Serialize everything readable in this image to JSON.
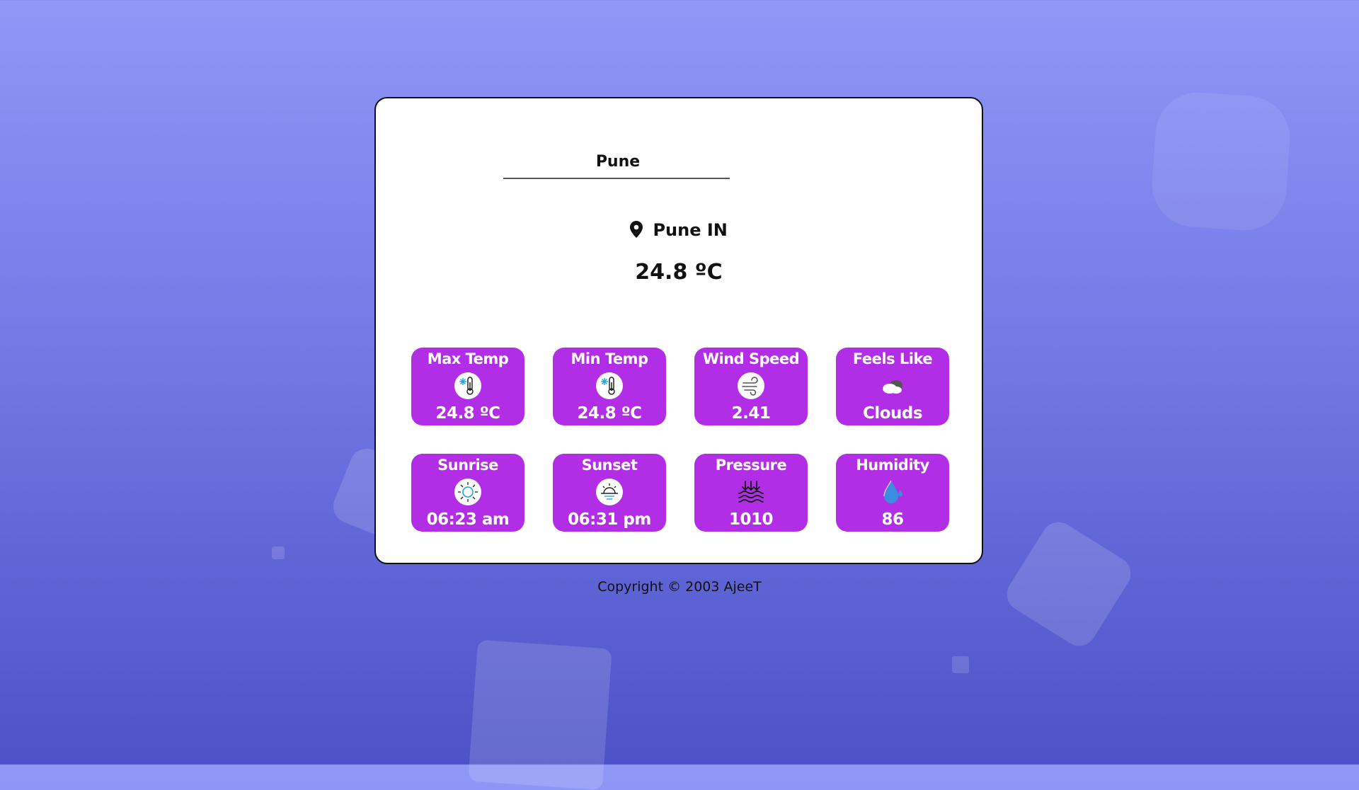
{
  "search": {
    "value": "Pune"
  },
  "location": {
    "text": "Pune IN",
    "icon": "map-pin-icon"
  },
  "current_temp": "24.8 ºC",
  "tiles": [
    {
      "label": "Max Temp",
      "value": "24.8 ºC",
      "icon": "thermometer-snow-icon"
    },
    {
      "label": "Min Temp",
      "value": "24.8 ºC",
      "icon": "thermometer-snow-icon"
    },
    {
      "label": "Wind Speed",
      "value": "2.41",
      "icon": "wind-icon"
    },
    {
      "label": "Feels Like",
      "value": "Clouds",
      "icon": "clouds-icon"
    },
    {
      "label": "Sunrise",
      "value": "06:23 am",
      "icon": "sun-icon"
    },
    {
      "label": "Sunset",
      "value": "06:31 pm",
      "icon": "sunset-icon"
    },
    {
      "label": "Pressure",
      "value": "1010",
      "icon": "pressure-icon"
    },
    {
      "label": "Humidity",
      "value": "86",
      "icon": "water-drop-icon"
    }
  ],
  "footer": "Copyright © 2003 AjeeT",
  "colors": {
    "tile_bg": "#b22ee6",
    "background_top": "#8f97f7",
    "background_bottom": "#4d52c7",
    "icon_accent": "#1aa7d8"
  }
}
